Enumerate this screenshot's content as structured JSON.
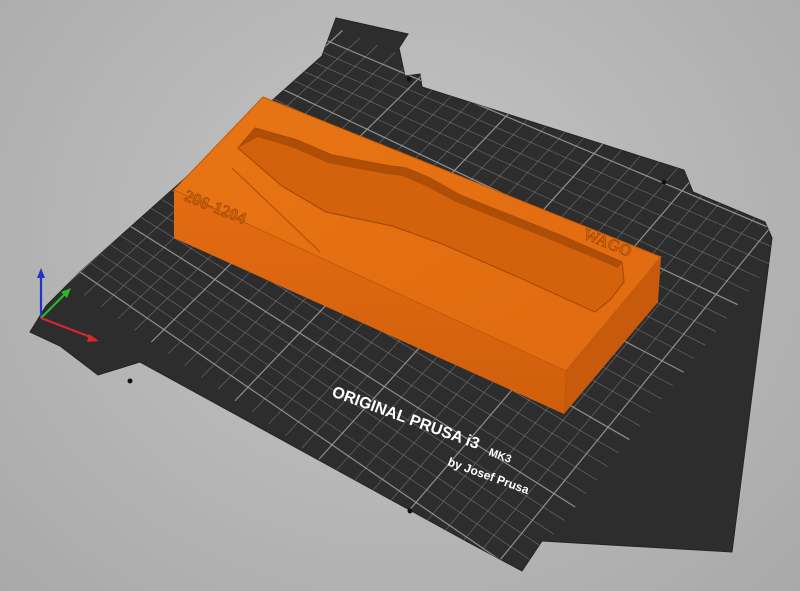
{
  "bed": {
    "brand_line": "ORIGINAL PRUSA i3",
    "model_line": "MK3",
    "maker_line": "by Josef Prusa"
  },
  "part": {
    "engraving_left": "206-1204",
    "engraving_right": "WAGO"
  },
  "axes": {
    "x_color": "#d8262b",
    "y_color": "#2db52d",
    "z_color": "#2234c8"
  },
  "colors": {
    "background": "#b8b8b8",
    "bed": "#2d2d2d",
    "grid": "#9a9a9a",
    "part": "#e56e12"
  }
}
